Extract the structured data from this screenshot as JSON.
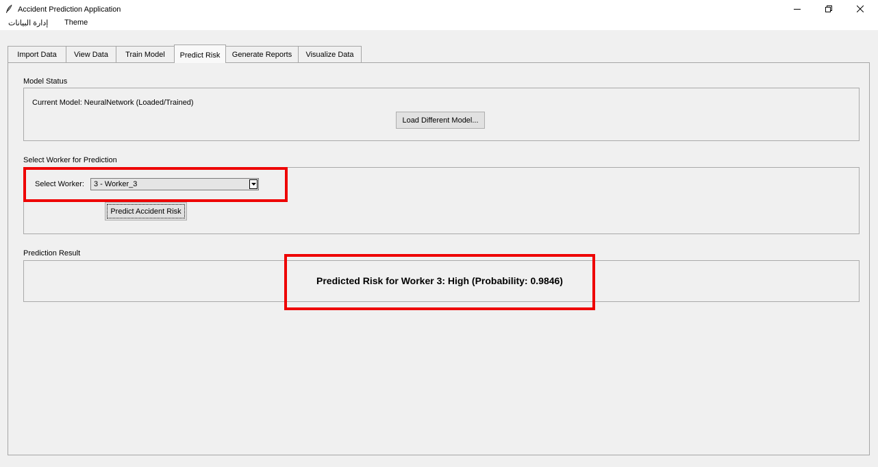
{
  "window": {
    "title": "Accident Prediction Application",
    "minimize_icon": "minimize-icon",
    "restore_icon": "restore-icon",
    "close_icon": "close-icon"
  },
  "menu": {
    "items": [
      "إدارة البيانات",
      "Theme"
    ]
  },
  "tabs": [
    {
      "label": "Import Data"
    },
    {
      "label": "View Data"
    },
    {
      "label": "Train Model"
    },
    {
      "label": "Predict Risk"
    },
    {
      "label": "Generate Reports"
    },
    {
      "label": "Visualize Data"
    }
  ],
  "active_tab": "Predict Risk",
  "model_status": {
    "group_label": "Model Status",
    "current_model": "Current Model: NeuralNetwork (Loaded/Trained)",
    "load_button": "Load Different Model..."
  },
  "worker_selection": {
    "group_label": "Select Worker for Prediction",
    "select_label": "Select Worker:",
    "selected_value": "3 - Worker_3",
    "predict_button": "Predict Accident Risk"
  },
  "prediction_result": {
    "group_label": "Prediction Result",
    "text": "Predicted Risk for Worker 3: High (Probability: 0.9846)"
  },
  "colors": {
    "highlight": "#ee0000",
    "window_bg": "#f0f0f0",
    "button_bg": "#e1e1e1"
  }
}
